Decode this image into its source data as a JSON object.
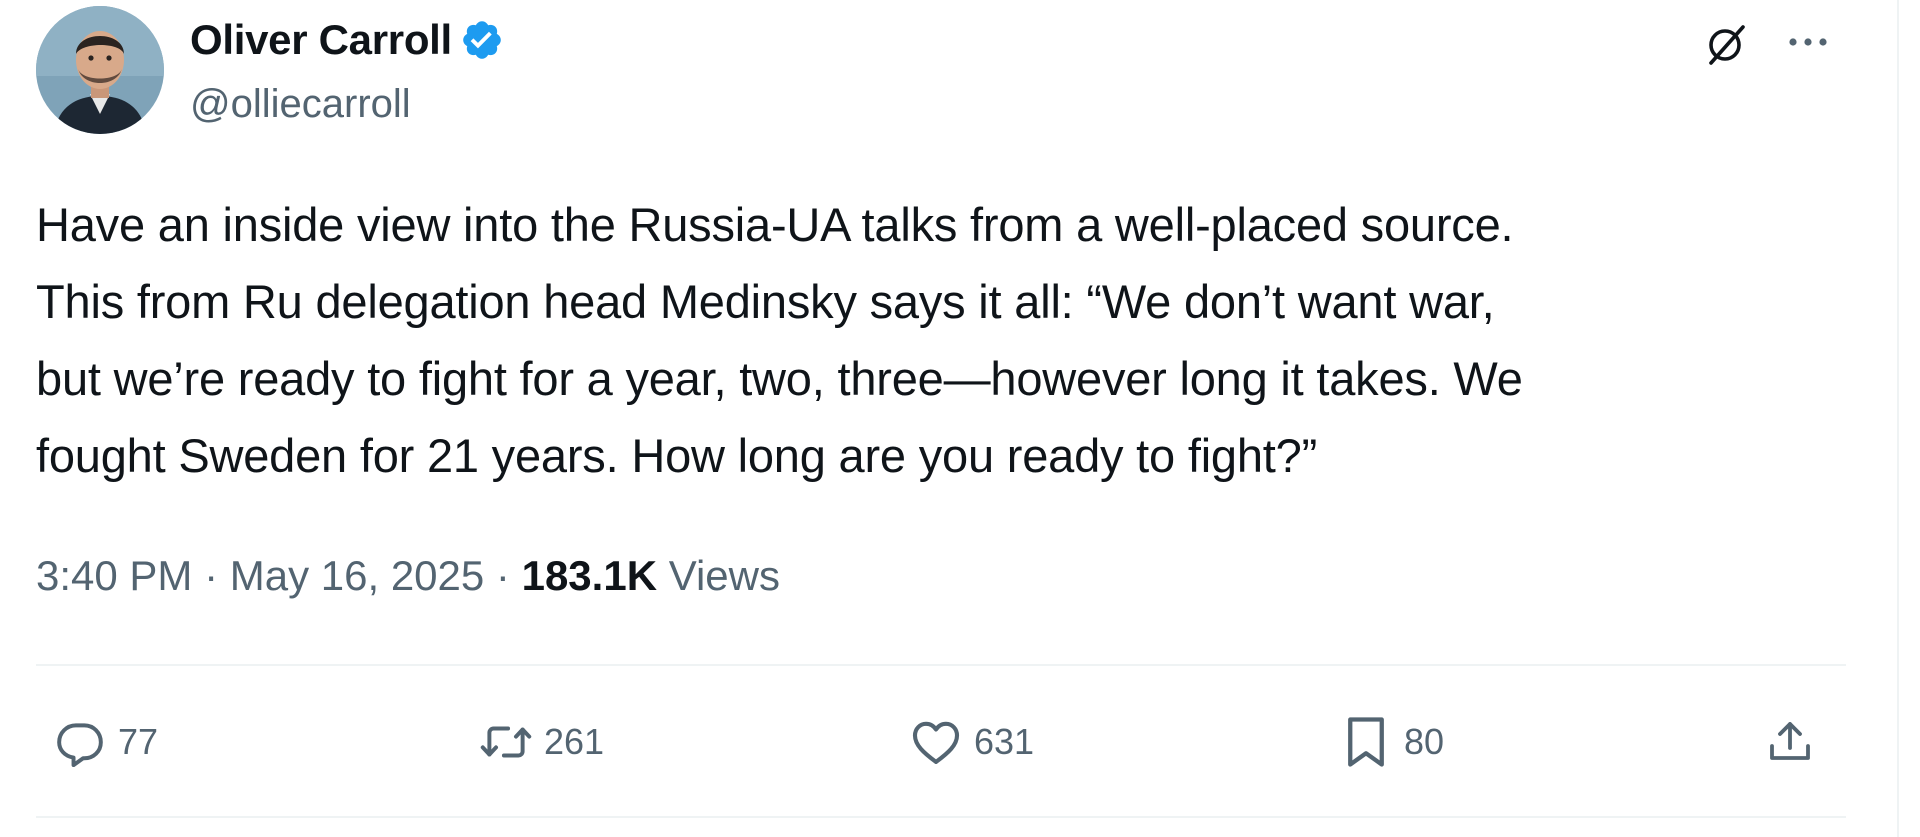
{
  "author": {
    "display_name": "Oliver Carroll",
    "handle": "@olliecarroll",
    "verified": true
  },
  "icons": {
    "verified": "verified-badge-icon",
    "grok": "grok-icon",
    "more": "more-options-icon",
    "reply": "reply-icon",
    "retweet": "retweet-icon",
    "like": "heart-icon",
    "bookmark": "bookmark-icon",
    "share": "share-icon"
  },
  "tweet": {
    "text": "Have an inside view into the Russia-UA talks from a well-placed source.\nThis from Ru delegation head Medinsky says it all: “We don’t want war,\nbut we’re ready to fight for a year, two, three—however long it takes. We\nfought Sweden for 21 years. How long are you ready to fight?”",
    "time": "3:40 PM",
    "separator": " · ",
    "date": "May 16, 2025",
    "views_count": "183.1K",
    "views_label": " Views"
  },
  "actions": {
    "replies": "77",
    "retweets": "261",
    "likes": "631",
    "bookmarks": "80"
  },
  "colors": {
    "text_primary": "#0f1419",
    "text_secondary": "#536471",
    "verified_blue": "#1d9bf0",
    "divider": "#eff3f4"
  }
}
